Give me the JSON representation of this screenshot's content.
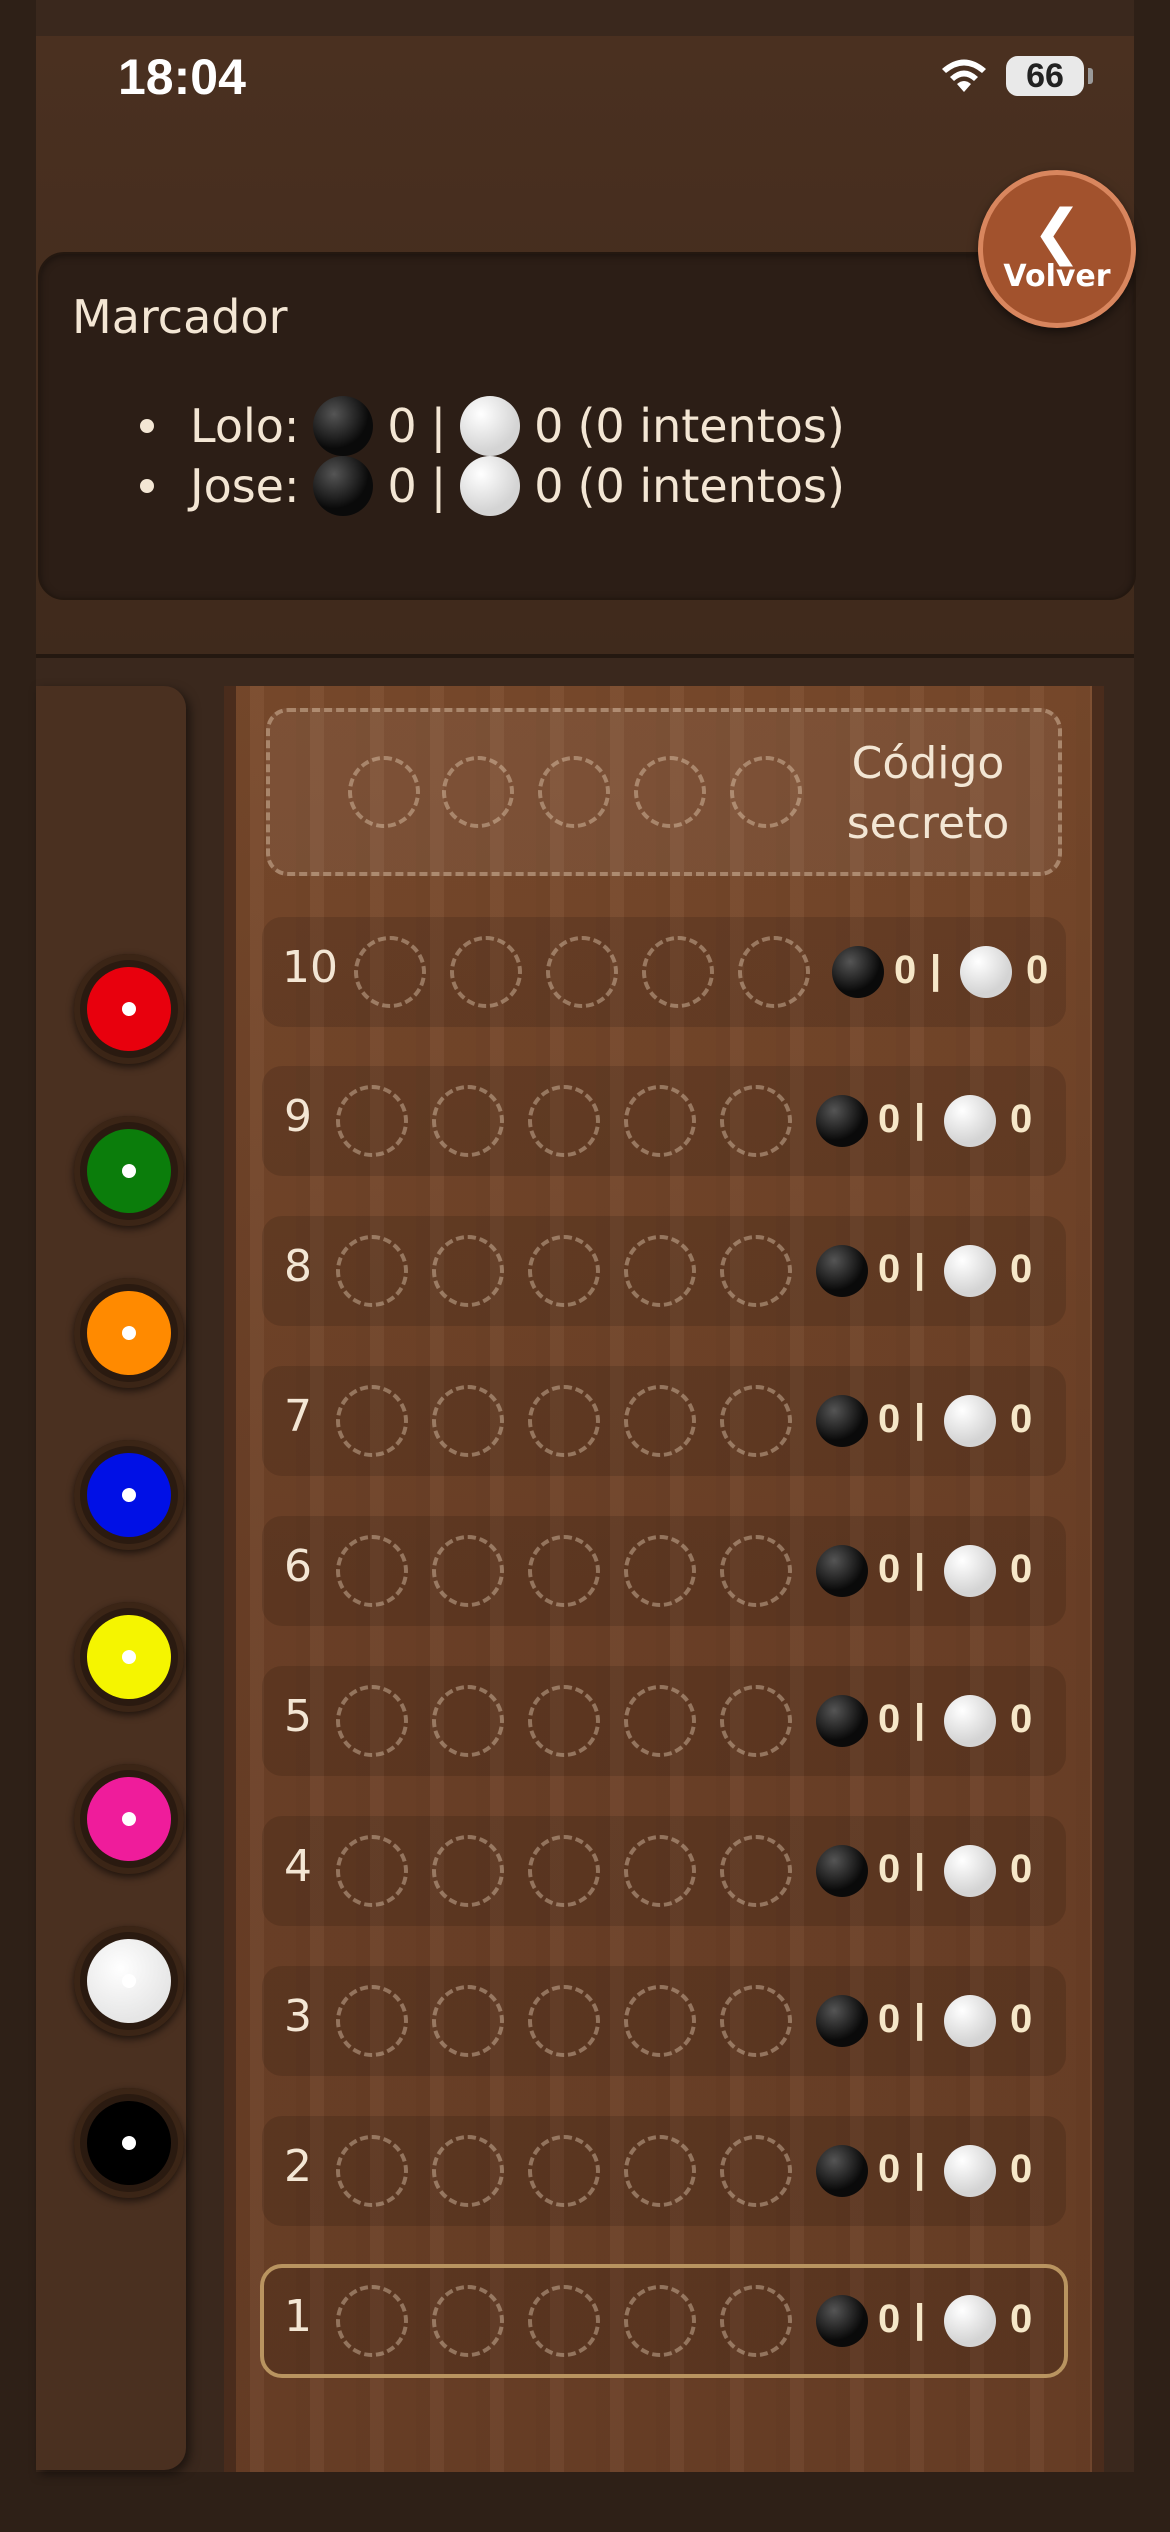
{
  "status_bar": {
    "time": "18:04",
    "battery": "66"
  },
  "back_button": {
    "label": "Volver",
    "chevron": "❮"
  },
  "scoreboard": {
    "title": "Marcador",
    "players": [
      {
        "name": "Lolo:",
        "black": "0",
        "separator": "|",
        "white": "0",
        "attempts": "(0 intentos)"
      },
      {
        "name": "Jose:",
        "black": "0",
        "separator": "|",
        "white": "0",
        "attempts": "(0 intentos)"
      }
    ]
  },
  "palette": {
    "colors": [
      {
        "name": "red",
        "hex": "#e8000d"
      },
      {
        "name": "green",
        "hex": "#0b7d0b"
      },
      {
        "name": "orange",
        "hex": "#ff8a00"
      },
      {
        "name": "blue",
        "hex": "#0010e6"
      },
      {
        "name": "yellow",
        "hex": "#f5f500"
      },
      {
        "name": "pink",
        "hex": "#ef1c9b"
      },
      {
        "name": "white",
        "hex": "#ffffff"
      },
      {
        "name": "black",
        "hex": "#000000"
      }
    ]
  },
  "board": {
    "secret_label": "Código secreto",
    "rows": [
      {
        "number": "10",
        "black": "0",
        "separator": "|",
        "white": "0"
      },
      {
        "number": "9",
        "black": "0",
        "separator": "|",
        "white": "0"
      },
      {
        "number": "8",
        "black": "0",
        "separator": "|",
        "white": "0"
      },
      {
        "number": "7",
        "black": "0",
        "separator": "|",
        "white": "0"
      },
      {
        "number": "6",
        "black": "0",
        "separator": "|",
        "white": "0"
      },
      {
        "number": "5",
        "black": "0",
        "separator": "|",
        "white": "0"
      },
      {
        "number": "4",
        "black": "0",
        "separator": "|",
        "white": "0"
      },
      {
        "number": "3",
        "black": "0",
        "separator": "|",
        "white": "0"
      },
      {
        "number": "2",
        "black": "0",
        "separator": "|",
        "white": "0"
      },
      {
        "number": "1",
        "black": "0",
        "separator": "|",
        "white": "0"
      }
    ],
    "active_row": "1"
  }
}
